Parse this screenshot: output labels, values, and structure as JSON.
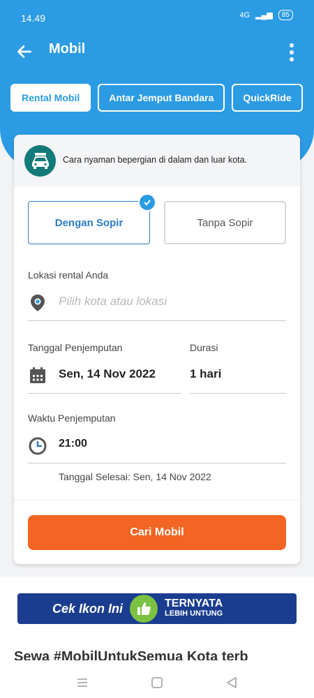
{
  "status_bar": {
    "time": "14.49",
    "network": "4G",
    "battery": "85"
  },
  "app_bar": {
    "title": "Mobil"
  },
  "tabs": [
    {
      "label": "Rental Mobil",
      "active": true
    },
    {
      "label": "Antar Jemput Bandara",
      "active": false
    },
    {
      "label": "QuickRide",
      "active": false
    }
  ],
  "banner": {
    "text": "Cara nyaman bepergian di dalam dan luar kota."
  },
  "driver_options": {
    "with_driver": "Dengan Sopir",
    "without_driver": "Tanpa Sopir",
    "selected": "Dengan Sopir"
  },
  "location": {
    "label": "Lokasi rental Anda",
    "placeholder": "Pilih kota atau lokasi"
  },
  "pickup_date": {
    "label": "Tanggal Penjemputan",
    "value": "Sen, 14 Nov 2022"
  },
  "duration": {
    "label": "Durasi",
    "value": "1 hari"
  },
  "pickup_time": {
    "label": "Waktu Penjemputan",
    "value": "21:00"
  },
  "end_date": {
    "text": "Tanggal Selesai: Sen, 14 Nov 2022"
  },
  "search_button": {
    "label": "Cari Mobil"
  },
  "promo": {
    "left_text": "Cek Ikon Ini",
    "right_big": "TERNYATA",
    "right_small": "LEBIH UNTUNG"
  },
  "section_heading": {
    "text": "Sewa #MobilUntukSemua Kota terb"
  },
  "colors": {
    "primary": "#2b9be3",
    "accent_button": "#f26522",
    "banner_icon_bg": "#137a7a"
  },
  "icons": [
    "back-arrow-icon",
    "more-vert-icon",
    "car-icon",
    "check-icon",
    "location-pin-icon",
    "calendar-icon",
    "clock-icon",
    "thumbs-up-icon",
    "nav-menu-icon",
    "nav-home-icon",
    "nav-back-icon"
  ]
}
